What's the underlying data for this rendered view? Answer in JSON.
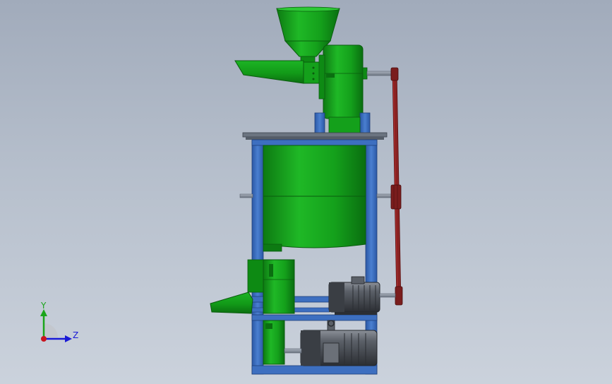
{
  "triad": {
    "y_label": "Y",
    "z_label": "Z",
    "y_color": "#1aa51a",
    "z_color": "#1a1ad6",
    "x_color": "#c8141e"
  },
  "colors": {
    "machine_green": "#13a31a",
    "frame_blue": "#3d6fc0",
    "belt_red": "#7a1d1d",
    "motor_gray": "#4b4f55",
    "shaft_gray": "#7e8794",
    "background_top": "#a1abbb",
    "background_bottom": "#cbd2dc"
  }
}
